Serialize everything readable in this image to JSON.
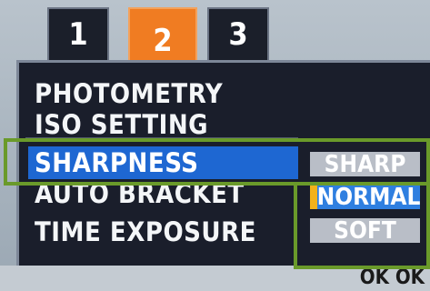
{
  "tabs": [
    {
      "label": "1"
    },
    {
      "label": "2"
    },
    {
      "label": "3"
    }
  ],
  "menu": {
    "items": [
      {
        "label": "PHOTOMETRY"
      },
      {
        "label": "ISO SETTING"
      },
      {
        "label": "SHARPNESS"
      },
      {
        "label": "AUTO BRACKET"
      },
      {
        "label": "TIME EXPOSURE"
      }
    ],
    "selected": "SHARPNESS"
  },
  "options": [
    {
      "label": "SHARP"
    },
    {
      "label": "NORMAL"
    },
    {
      "label": "SOFT"
    }
  ],
  "active_option": "NORMAL",
  "footer": {
    "ok_label": "OK OK"
  },
  "colors": {
    "active_tab": "#f07c22",
    "selection": "#1e67d2",
    "highlight_frame": "#6a9a2a",
    "cursor_marker": "#f3b21a"
  }
}
